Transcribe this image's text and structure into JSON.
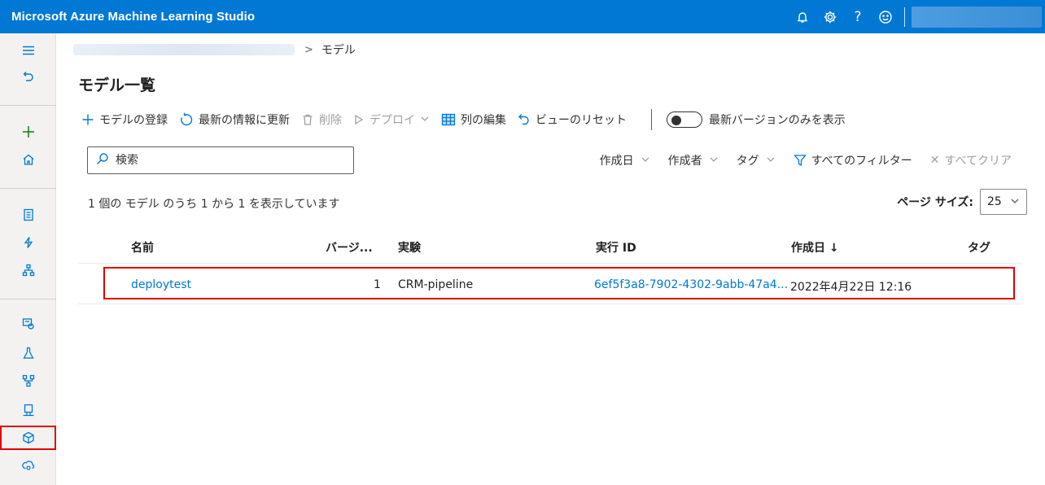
{
  "app": {
    "title": "Microsoft Azure Machine Learning Studio"
  },
  "topbar": {
    "icons": [
      "bell-icon",
      "gear-icon",
      "help-icon",
      "smiley-icon"
    ],
    "help_glyph": "?"
  },
  "breadcrumb": {
    "separator": ">",
    "current": "モデル"
  },
  "page": {
    "title": "モデル一覧"
  },
  "commands": {
    "register": "モデルの登録",
    "refresh": "最新の情報に更新",
    "delete": "削除",
    "deploy": "デプロイ",
    "edit_columns": "列の編集",
    "reset_view": "ビューのリセット",
    "latest_only": "最新バージョンのみを表示"
  },
  "search": {
    "placeholder": "検索"
  },
  "filters": {
    "created_date": "作成日",
    "created_by": "作成者",
    "tags": "タグ",
    "all_filters": "すべてのフィルター",
    "clear_all": "すべてクリア",
    "clear_glyph": "✕"
  },
  "list": {
    "count_text": "1 個の モデル のうち 1 から 1 を表示しています",
    "page_size_label": "ページ サイズ:",
    "page_size_value": "25"
  },
  "table": {
    "headers": {
      "name": "名前",
      "version": "バージ...",
      "experiment": "実験",
      "run_id": "実行 ID",
      "created": "作成日 ↓",
      "tags": "タグ"
    },
    "rows": [
      {
        "name": "deploytest",
        "version": "1",
        "experiment": "CRM-pipeline",
        "run_id": "6ef5f3a8-7902-4302-9abb-47a4...",
        "created": "2022年4月22日 12:16",
        "tags": ""
      }
    ]
  },
  "colors": {
    "accent": "#0078d4",
    "highlight": "#e00000"
  }
}
